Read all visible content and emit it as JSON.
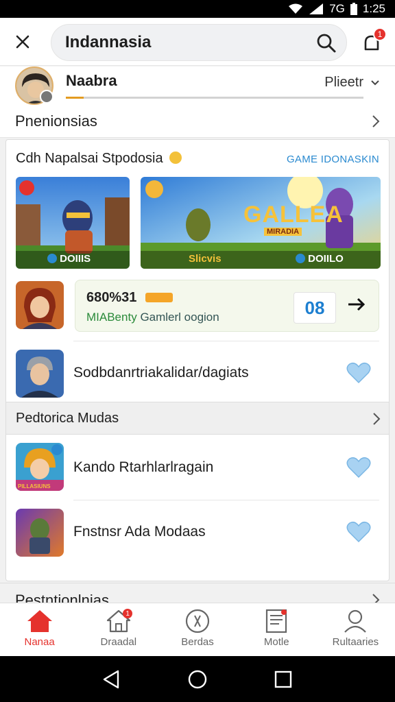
{
  "status_bar": {
    "network": "7G",
    "time": "1:25"
  },
  "header": {
    "search_value": "Indannasia",
    "notification_count": "1"
  },
  "profile": {
    "name": "Naabra",
    "progress_fraction": 0.06,
    "sort_label": "Plieetr"
  },
  "preferences_header": {
    "label": "Pnenionsias"
  },
  "card": {
    "title": "Cdh Napalsai Stpodosia",
    "link": "GAME IDONASKIN",
    "banners": [
      {
        "label": "DOIIIS"
      },
      {
        "title": "GALLEA",
        "subtitle": "MIRADIA",
        "left_label": "Slicvis",
        "right_label": "DOIILO"
      }
    ],
    "promo": {
      "value": "680%31",
      "sub_left": "MIABenty",
      "sub_right": "Gamlerl oogion",
      "count": "08"
    },
    "rows": [
      {
        "title": "Sodbdanrtriakalidar/dagiats"
      }
    ],
    "section2": {
      "label": "Pedtorica Mudas"
    },
    "rows2": [
      {
        "title": "Kando Rtarhlarlragain",
        "thumb_label": "PILLASIUNS"
      },
      {
        "title": "Fnstnsr Ada Modaas"
      }
    ],
    "section3": {
      "label": "Pestntionlnias"
    }
  },
  "bottom_nav": {
    "items": [
      {
        "label": "Nanaa",
        "icon": "home-icon"
      },
      {
        "label": "Draadal",
        "icon": "store-icon",
        "badge": "1"
      },
      {
        "label": "Berdas",
        "icon": "tag-icon"
      },
      {
        "label": "Motle",
        "icon": "document-icon"
      },
      {
        "label": "Rultaaries",
        "icon": "profile-icon"
      }
    ]
  },
  "colors": {
    "accent": "#e5322d",
    "link": "#2a8ad0",
    "heart": "#9cc9ee",
    "progress": "#e39b21"
  }
}
